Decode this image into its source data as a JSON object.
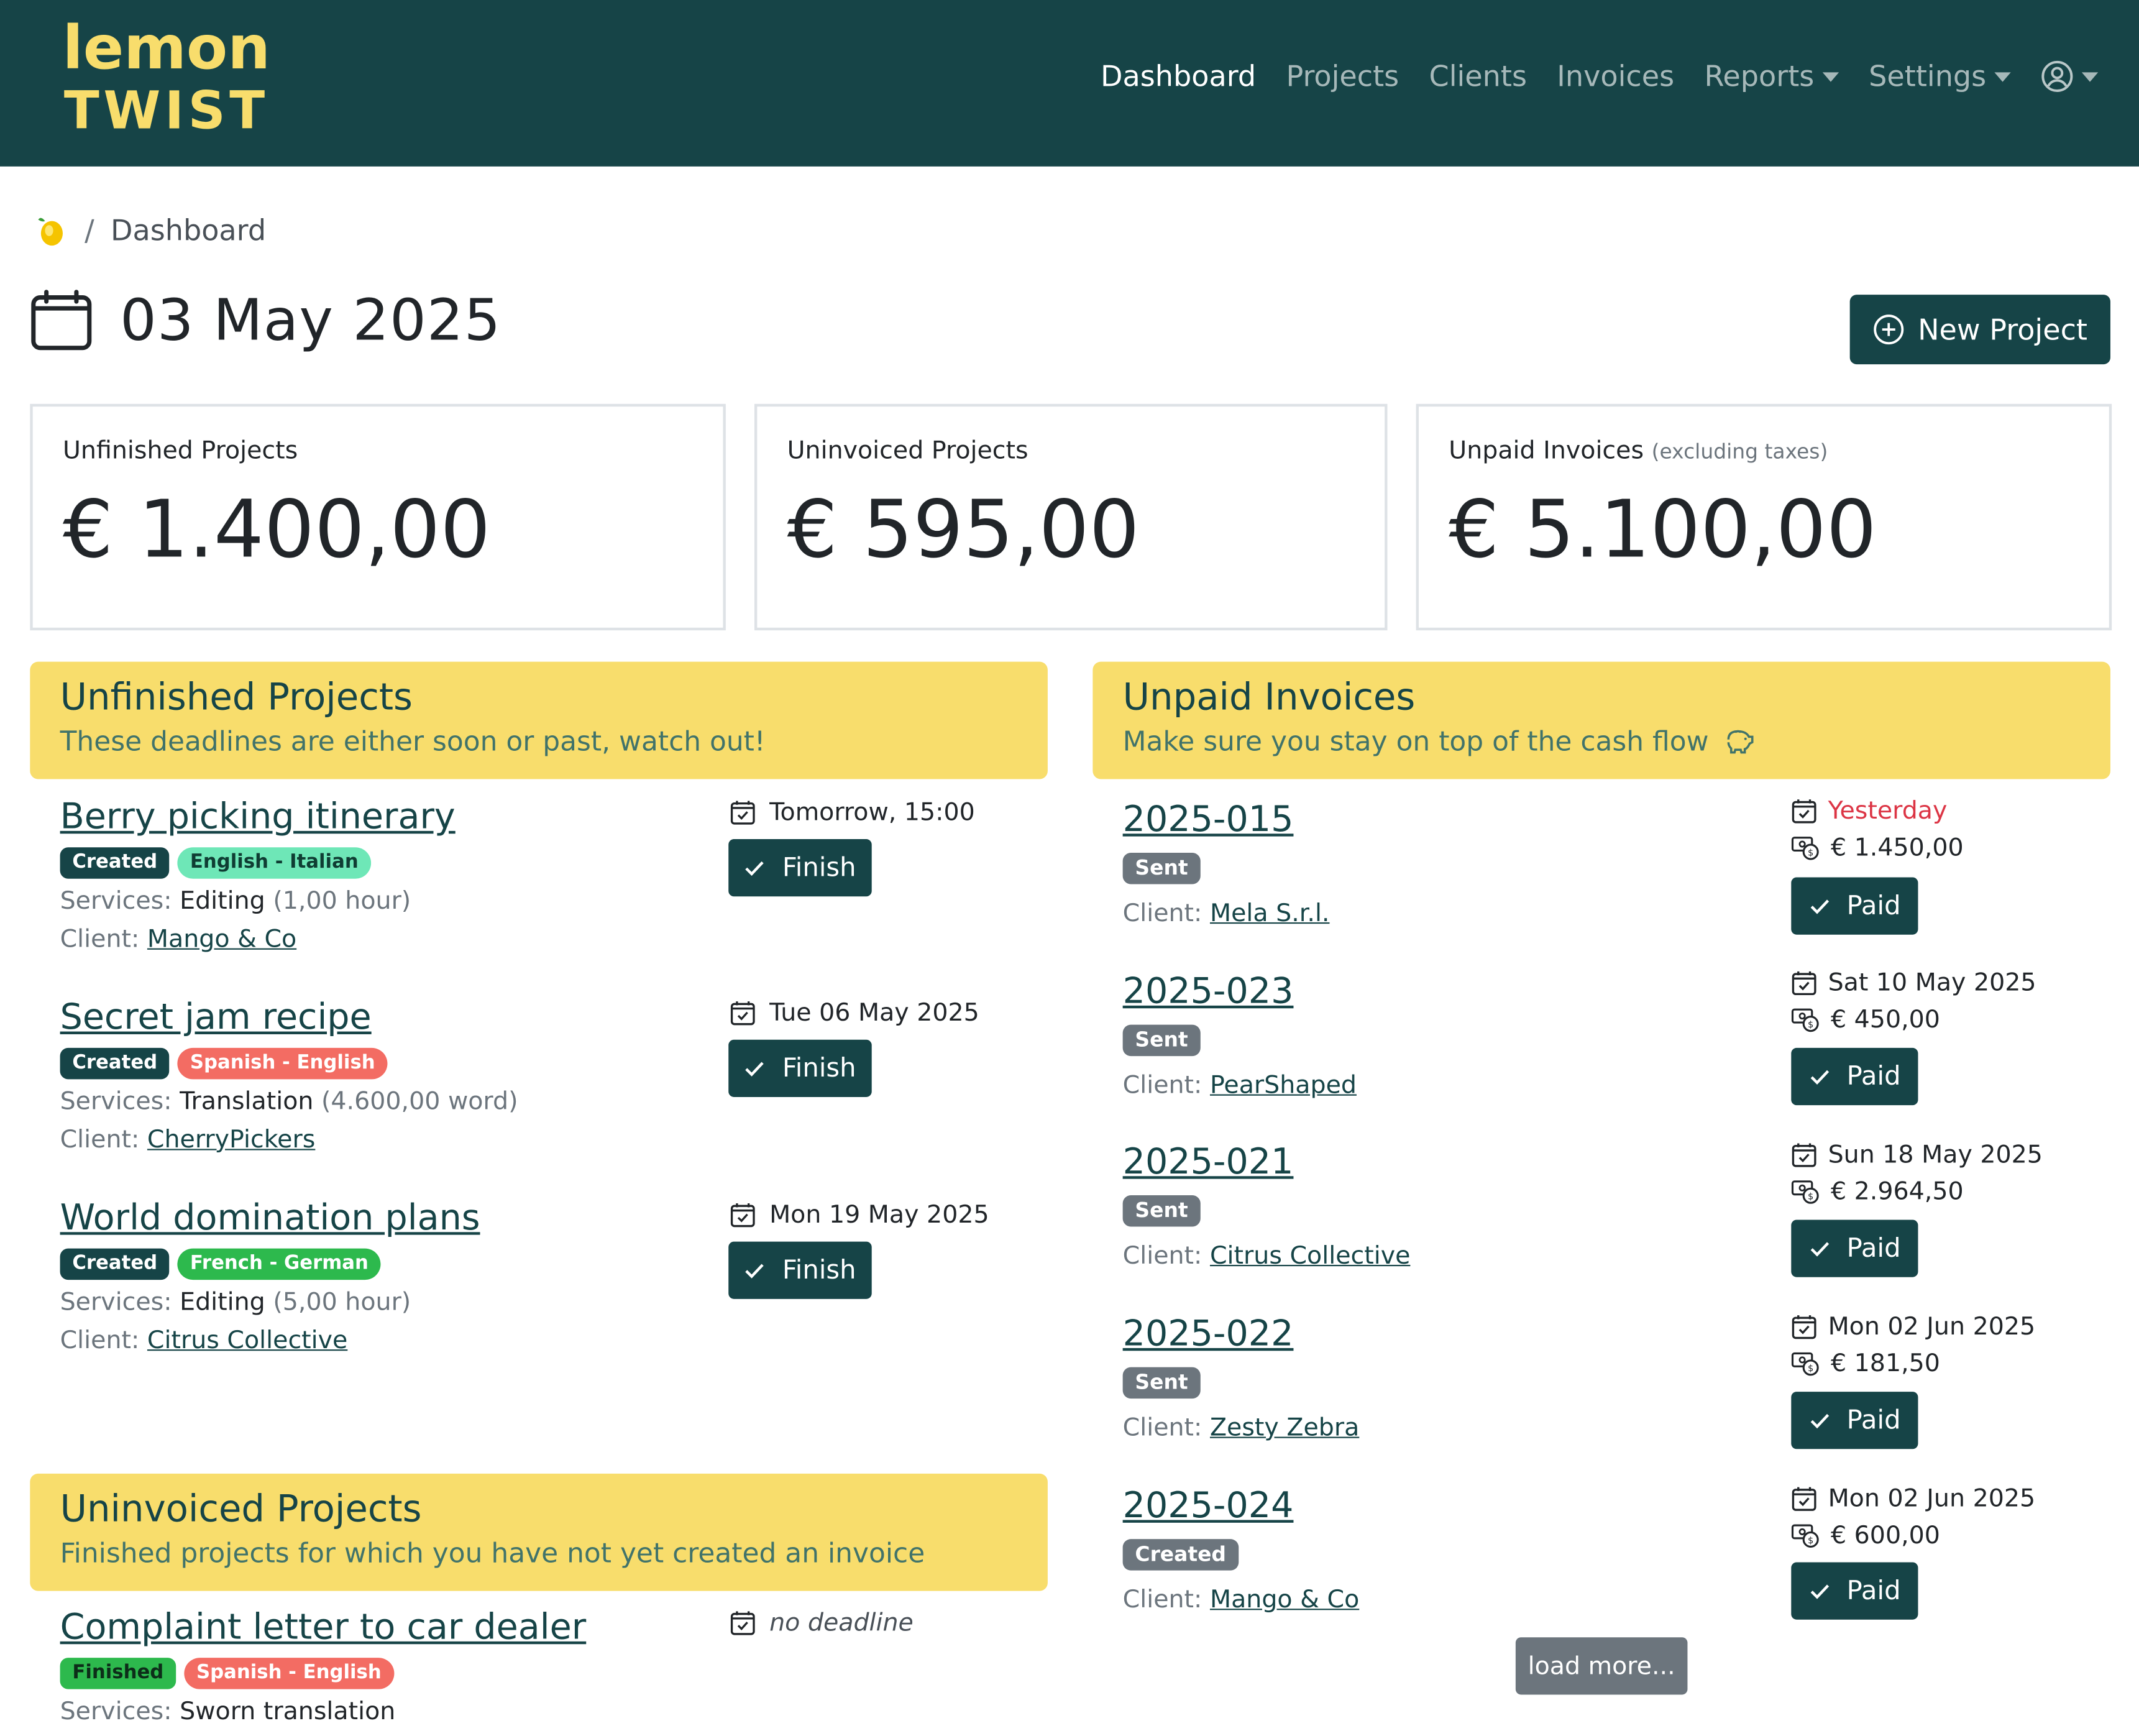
{
  "nav": {
    "logo_top": "lemon",
    "logo_bottom": "TWIST",
    "links": [
      {
        "label": "Dashboard"
      },
      {
        "label": "Projects"
      },
      {
        "label": "Clients"
      },
      {
        "label": "Invoices"
      },
      {
        "label": "Reports"
      },
      {
        "label": "Settings"
      }
    ],
    "user_icon": "user-circle-icon"
  },
  "breadcrumb": {
    "home_icon": "lemon-icon",
    "separator": "/",
    "current": "Dashboard"
  },
  "page": {
    "date": "03 May 2025",
    "new_project_label": "New Project"
  },
  "stats": [
    {
      "label": "Unfinished Projects",
      "note": "",
      "value": "€ 1.400,00"
    },
    {
      "label": "Uninvoiced Projects",
      "note": "",
      "value": "€ 595,00"
    },
    {
      "label": "Unpaid Invoices",
      "note": "(excluding taxes)",
      "value": "€ 5.100,00"
    }
  ],
  "unfinished": {
    "title": "Unfinished Projects",
    "subtitle": "These deadlines are either soon or past, watch out!",
    "items": [
      {
        "title": "Berry picking itinerary",
        "status": "Created",
        "lang": "English - Italian",
        "services_label": "Services:",
        "service": "Editing",
        "amount": "(1,00 hour)",
        "client_label": "Client:",
        "client": "Mango & Co",
        "deadline": "Tomorrow, 15:00",
        "action": "Finish"
      },
      {
        "title": "Secret jam recipe",
        "status": "Created",
        "lang": "Spanish - English",
        "services_label": "Services:",
        "service": "Translation",
        "amount": "(4.600,00 word)",
        "client_label": "Client:",
        "client": "CherryPickers",
        "deadline": "Tue 06 May 2025",
        "action": "Finish"
      },
      {
        "title": "World domination plans",
        "status": "Created",
        "lang": "French - German",
        "services_label": "Services:",
        "service": "Editing",
        "amount": "(5,00 hour)",
        "client_label": "Client:",
        "client": "Citrus Collective",
        "deadline": "Mon 19 May 2025",
        "action": "Finish"
      }
    ]
  },
  "uninvoiced": {
    "title": "Uninvoiced Projects",
    "subtitle": "Finished projects for which you have not yet created an invoice",
    "items": [
      {
        "title": "Complaint letter to car dealer",
        "status": "Finished",
        "lang": "Spanish - English",
        "services_label": "Services:",
        "service": "Sworn translation",
        "deadline": "no deadline"
      }
    ]
  },
  "unpaid": {
    "title": "Unpaid Invoices",
    "subtitle": "Make sure you stay on top of the cash flow",
    "subtitle_icon": "piggy-bank-icon",
    "items": [
      {
        "number": "2025-015",
        "status": "Sent",
        "client_label": "Client:",
        "client": "Mela S.r.l.",
        "due": "Yesterday",
        "amount": "€ 1.450,00",
        "action": "Paid"
      },
      {
        "number": "2025-023",
        "status": "Sent",
        "client_label": "Client:",
        "client": "PearShaped",
        "due": "Sat 10 May 2025",
        "amount": "€ 450,00",
        "action": "Paid"
      },
      {
        "number": "2025-021",
        "status": "Sent",
        "client_label": "Client:",
        "client": "Citrus Collective",
        "due": "Sun 18 May 2025",
        "amount": "€ 2.964,50",
        "action": "Paid"
      },
      {
        "number": "2025-022",
        "status": "Sent",
        "client_label": "Client:",
        "client": "Zesty Zebra",
        "due": "Mon 02 Jun 2025",
        "amount": "€ 181,50",
        "action": "Paid"
      },
      {
        "number": "2025-024",
        "status": "Created",
        "client_label": "Client:",
        "client": "Mango & Co",
        "due": "Mon 02 Jun 2025",
        "amount": "€ 600,00",
        "action": "Paid"
      }
    ],
    "load_more": "load more..."
  },
  "colors": {
    "brand": "#164447",
    "accent": "#f8dd6c",
    "danger": "#dc3545"
  }
}
